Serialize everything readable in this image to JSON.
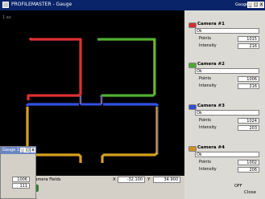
{
  "window": {
    "title": "PROFILEMASTER - Gauge"
  },
  "gauge_window": {
    "title": "Gauge 1"
  },
  "plot": {
    "corner_label": "1 ax"
  },
  "cameras": [
    {
      "name": "Camera #1",
      "status": "Ok",
      "points_label": "Points",
      "points": "1015",
      "intensity_label": "Intensity",
      "intensity": "216",
      "color": "#d03030"
    },
    {
      "name": "Camera #2",
      "status": "Ok",
      "points_label": "Points",
      "points": "1006",
      "intensity_label": "Intensity",
      "intensity": "216",
      "color": "#4caa30"
    },
    {
      "name": "Camera #3",
      "status": "Ok",
      "points_label": "Points",
      "points": "1024",
      "intensity_label": "Intensity",
      "intensity": "203",
      "color": "#3050d0"
    },
    {
      "name": "Camera #4",
      "status": "Ok",
      "points_label": "Points",
      "points": "1002",
      "intensity_label": "Intensity",
      "intensity": "206",
      "color": "#d09020"
    }
  ],
  "bottom": {
    "camera_fields_label": "Camera Fields",
    "x_label": "X",
    "x_value": "-32.100",
    "y_label": "Y",
    "y_value": "34.900",
    "off_label": "OFF",
    "close_label": "Close"
  },
  "subwindow": {
    "title": "Gauge 1",
    "value1": "1006",
    "value2": "111"
  }
}
